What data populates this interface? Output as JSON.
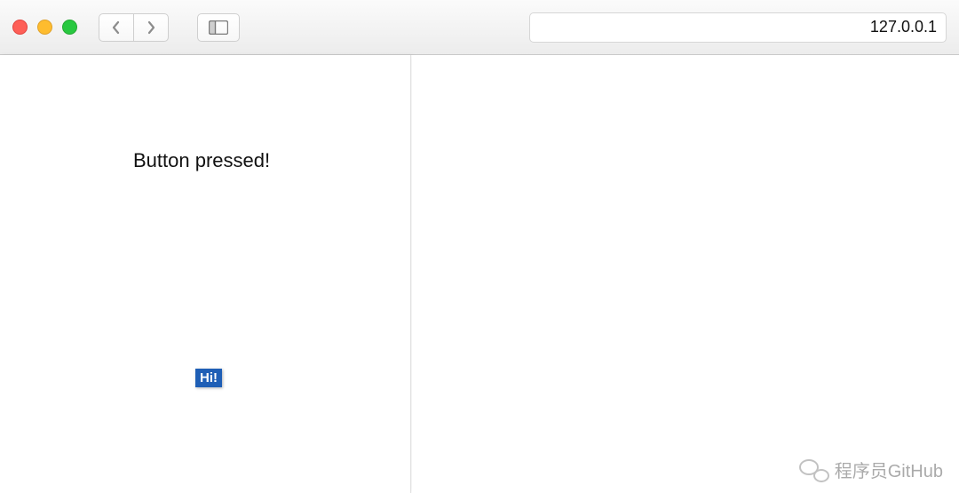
{
  "toolbar": {
    "address": "127.0.0.1"
  },
  "pane": {
    "status_text": "Button pressed!",
    "hi_button_label": "Hi!"
  },
  "watermark": {
    "text": "程序员GitHub"
  }
}
